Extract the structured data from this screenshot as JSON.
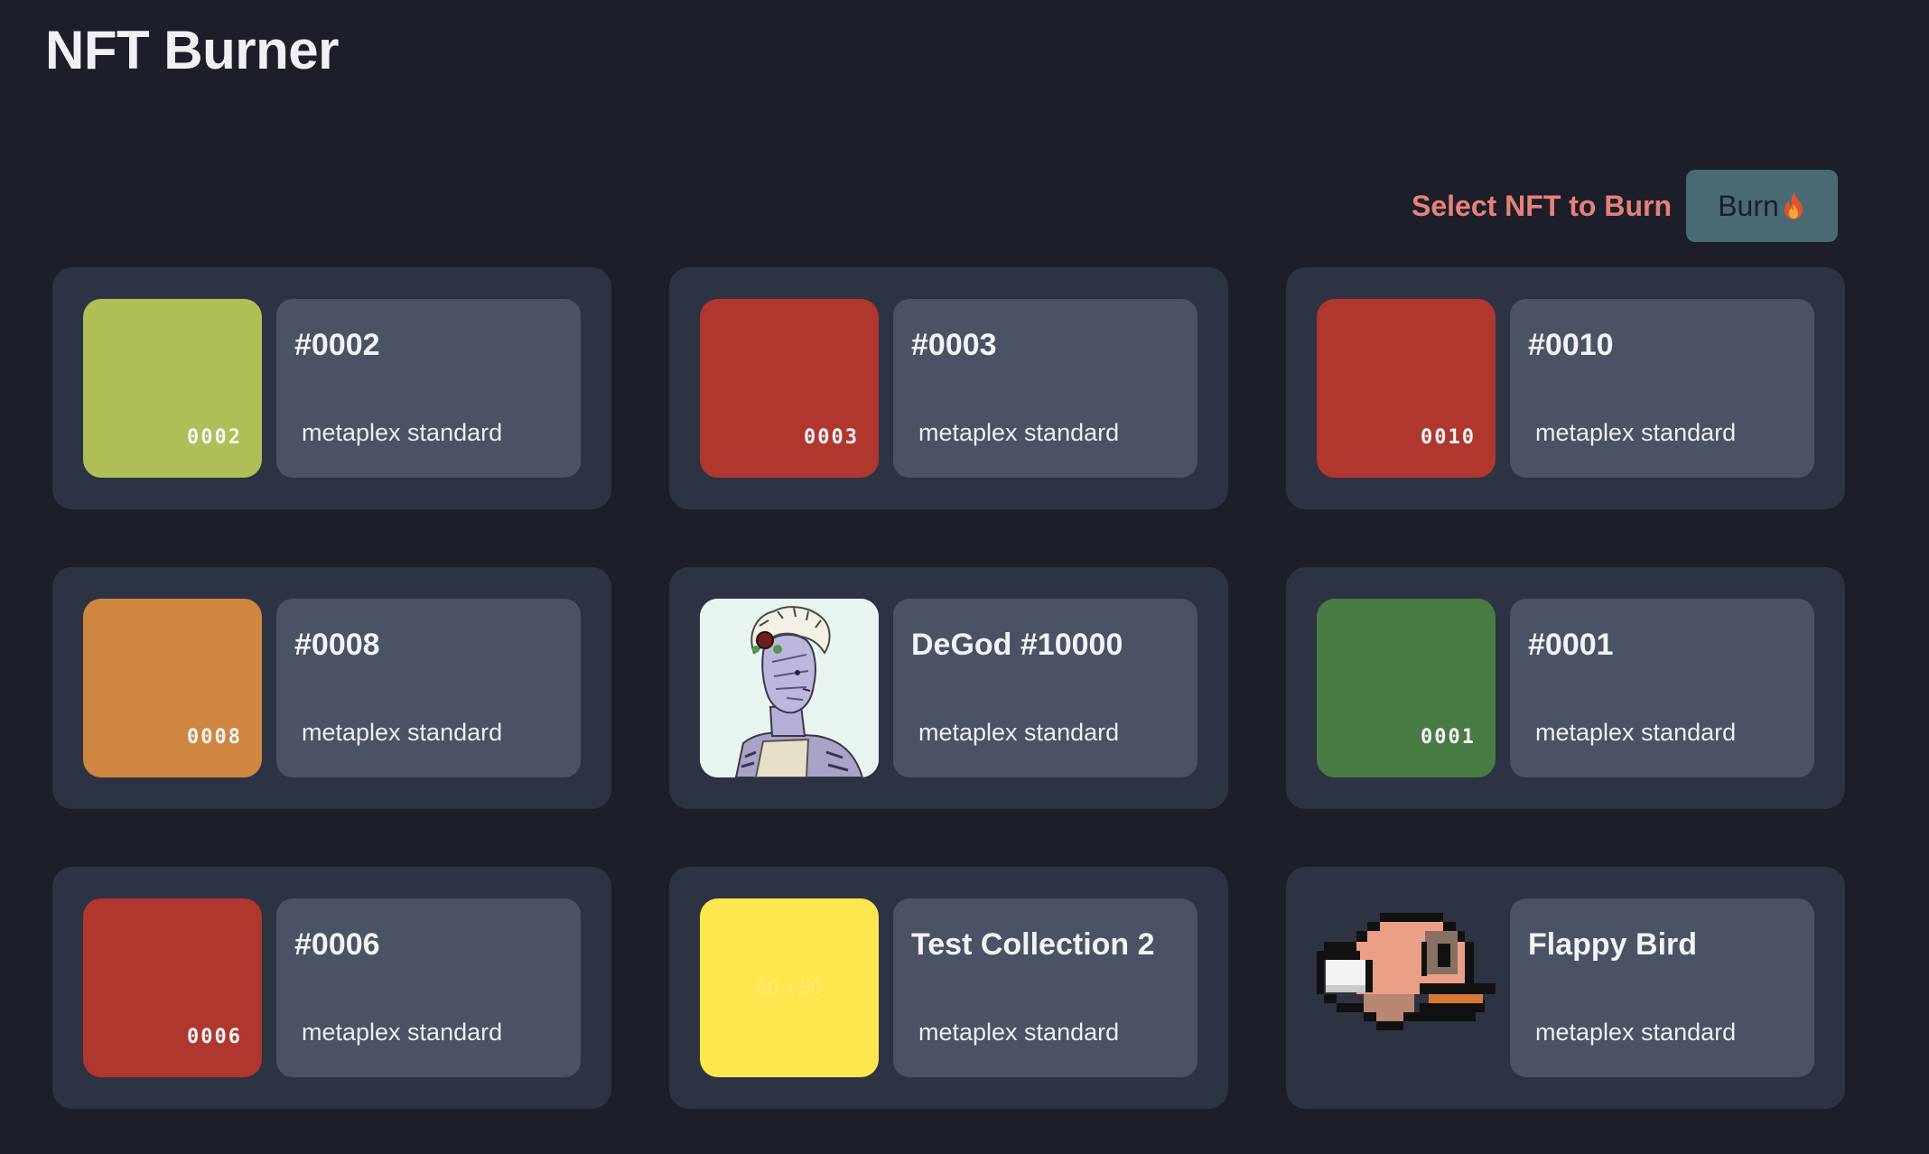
{
  "app": {
    "title": "NFT Burner"
  },
  "toolbar": {
    "prompt": "Select NFT to Burn",
    "burn_label": "Burn",
    "burn_icon": "fire-icon"
  },
  "nfts": [
    {
      "name": "#0002",
      "standard": "metaplex standard",
      "image_label": "0002",
      "color": "#b0be58"
    },
    {
      "name": "#0003",
      "standard": "metaplex standard",
      "image_label": "0003",
      "color": "#b0372e"
    },
    {
      "name": "#0010",
      "standard": "metaplex standard",
      "image_label": "0010",
      "color": "#b0372e"
    },
    {
      "name": "#0008",
      "standard": "metaplex standard",
      "image_label": "0008",
      "color": "#ce8641"
    },
    {
      "name": "DeGod #10000",
      "standard": "metaplex standard",
      "image_label": "",
      "color": "#e8f4f0"
    },
    {
      "name": "#0001",
      "standard": "metaplex standard",
      "image_label": "0001",
      "color": "#497b44"
    },
    {
      "name": "#0006",
      "standard": "metaplex standard",
      "image_label": "0006",
      "color": "#b0372e"
    },
    {
      "name": "Test Collection 2",
      "standard": "metaplex standard",
      "image_label": "50 x 50",
      "color": "#fde74f"
    },
    {
      "name": "Flappy Bird",
      "standard": "metaplex standard",
      "image_label": "",
      "color": "#2d3342"
    }
  ]
}
